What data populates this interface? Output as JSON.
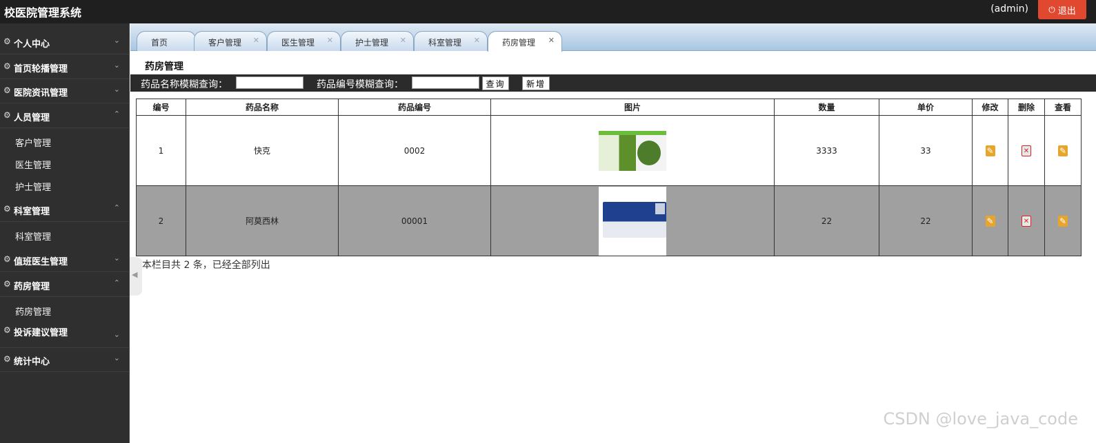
{
  "header": {
    "title": "校医院管理系统",
    "user": "(admin)",
    "logout_label": "退出"
  },
  "sidebar": {
    "groups": [
      {
        "label": "个人中心"
      },
      {
        "label": "首页轮播管理"
      },
      {
        "label": "医院资讯管理"
      },
      {
        "label": "人员管理",
        "children": [
          "客户管理",
          "医生管理",
          "护士管理"
        ]
      },
      {
        "label": "科室管理",
        "children": [
          "科室管理"
        ]
      },
      {
        "label": "值班医生管理"
      },
      {
        "label": "药房管理",
        "children": [
          "药房管理"
        ]
      },
      {
        "label": "投诉建议管理"
      },
      {
        "label": "统计中心"
      }
    ]
  },
  "tabs": [
    {
      "label": "首页"
    },
    {
      "label": "客户管理"
    },
    {
      "label": "医生管理"
    },
    {
      "label": "护士管理"
    },
    {
      "label": "科室管理"
    },
    {
      "label": "药房管理",
      "active": true
    }
  ],
  "page": {
    "title": "药房管理",
    "search_name_label": "药品名称模糊查询：",
    "search_code_label": "药品编号模糊查询：",
    "search_name_value": "",
    "search_code_value": "",
    "query_button": "查询",
    "add_button": "新增"
  },
  "table": {
    "headers": [
      "编号",
      "药品名称",
      "药品编号",
      "图片",
      "数量",
      "单价",
      "修改",
      "删除",
      "查看"
    ],
    "rows": [
      {
        "id": "1",
        "name": "快克",
        "code": "0002",
        "image": "medicine-box-image",
        "quantity": "3333",
        "price": "33"
      },
      {
        "id": "2",
        "name": "阿莫西林",
        "code": "00001",
        "image": "medicine-box-image",
        "quantity": "22",
        "price": "22"
      }
    ]
  },
  "footer": {
    "summary": "本栏目共 2 条，已经全部列出"
  },
  "watermark": "CSDN @love_java_code"
}
